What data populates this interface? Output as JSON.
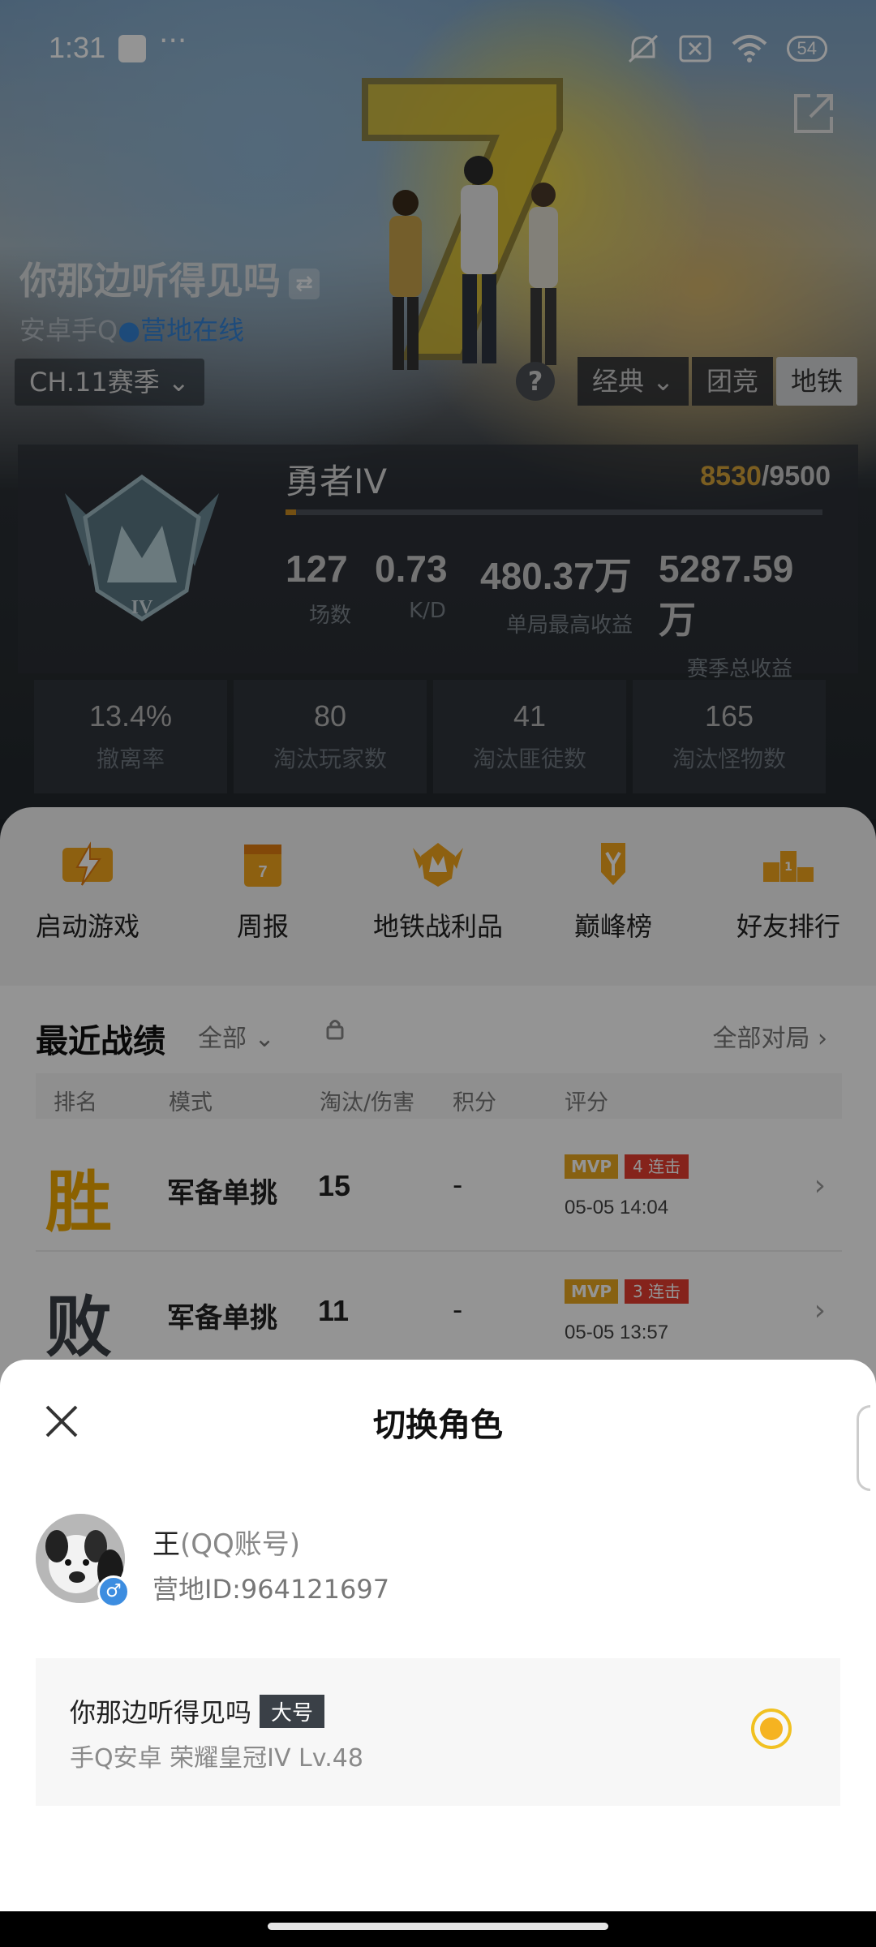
{
  "status_bar": {
    "time": "1:31",
    "dots": "···",
    "battery": "54",
    "wifi_sub": "6"
  },
  "profile": {
    "game_name": "你那边听得见吗",
    "swap_glyph": "⇄",
    "platform": "安卓手Q",
    "online_status": "●营地在线"
  },
  "filters": {
    "season": "CH.11赛季 ⌄",
    "help": "?",
    "modes": [
      "经典 ⌄",
      "团竞",
      "地铁"
    ],
    "active_mode": "地铁"
  },
  "rank": {
    "name": "勇者IV",
    "score_current": "8530",
    "score_total": "/9500",
    "progress_fraction": 0.02,
    "stats": [
      {
        "value": "127",
        "label": "场数"
      },
      {
        "value": "0.73",
        "label": "K/D"
      },
      {
        "value": "480.37万",
        "label": "单局最高收益"
      },
      {
        "value": "5287.59万",
        "label": "赛季总收益"
      }
    ]
  },
  "mini_stats": [
    {
      "value": "13.4%",
      "label": "撤离率"
    },
    {
      "value": "80",
      "label": "淘汰玩家数"
    },
    {
      "value": "41",
      "label": "淘汰匪徒数"
    },
    {
      "value": "165",
      "label": "淘汰怪物数"
    }
  ],
  "quick_actions": [
    {
      "label": "启动游戏",
      "icon": "lightning-icon"
    },
    {
      "label": "周报",
      "icon": "calendar-icon"
    },
    {
      "label": "地铁战利品",
      "icon": "metro-badge-icon"
    },
    {
      "label": "巅峰榜",
      "icon": "trophy-icon"
    },
    {
      "label": "好友排行",
      "icon": "podium-icon"
    }
  ],
  "recent": {
    "title": "最近战绩",
    "filter": "全部 ⌄",
    "all_matches": "全部对局 ›",
    "headers": [
      "排名",
      "模式",
      "淘汰/伤害",
      "积分",
      "评分"
    ],
    "rows": [
      {
        "result": "胜",
        "mode": "军备单挑",
        "kills": "15",
        "points": "-",
        "mvp": "MVP",
        "streak": "4 连击",
        "time": "05-05 14:04",
        "color": "#f0a800"
      },
      {
        "result": "败",
        "mode": "军备单挑",
        "kills": "11",
        "points": "-",
        "mvp": "MVP",
        "streak": "3 连击",
        "time": "05-05 13:57",
        "color": "#3a3f45"
      }
    ]
  },
  "sheet": {
    "title": "切换角色",
    "user_name": "王",
    "account_type": "(QQ账号)",
    "camp_id": "营地ID:964121697",
    "gender": "♂",
    "role": {
      "name": "你那边听得见吗",
      "tag": "大号",
      "info": "手Q安卓   荣耀皇冠IV   Lv.48",
      "selected": true
    }
  },
  "colors": {
    "accent": "#f5b321",
    "online": "#2b7fd9",
    "win": "#f0a800",
    "streak": "#e53d30"
  }
}
